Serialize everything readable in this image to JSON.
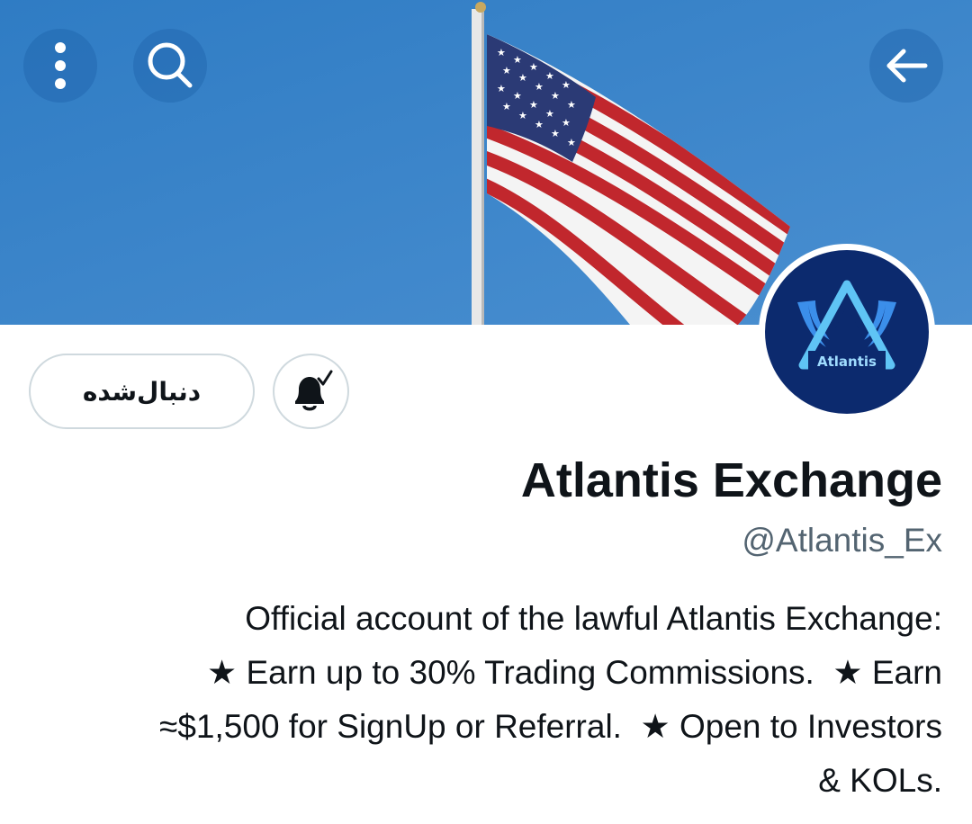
{
  "header": {
    "menu_icon": "more-vertical-icon",
    "search_icon": "search-icon",
    "back_icon": "arrow-back-icon",
    "banner_image": "american-flag-on-pole-blue-sky"
  },
  "profile": {
    "avatar_text": "Atlantis",
    "follow_label": "دنبال‌شده",
    "notification_icon": "bell-check-icon",
    "display_name": "Atlantis Exchange",
    "handle": "@Atlantis_Ex",
    "bio": "Official account of the lawful Atlantis Exchange:\n★ Earn up to 30% Trading Commissions.  ★ Earn\n≈$1,500 for SignUp or Referral.  ★ Open to Investors\n& KOLs."
  },
  "colors": {
    "sky": "#3d85c8",
    "avatar_bg": "#0c2a6e",
    "logo_blue": "#3b8eea",
    "text_primary": "#0f1419",
    "text_secondary": "#536471",
    "border": "#cfd9de"
  }
}
